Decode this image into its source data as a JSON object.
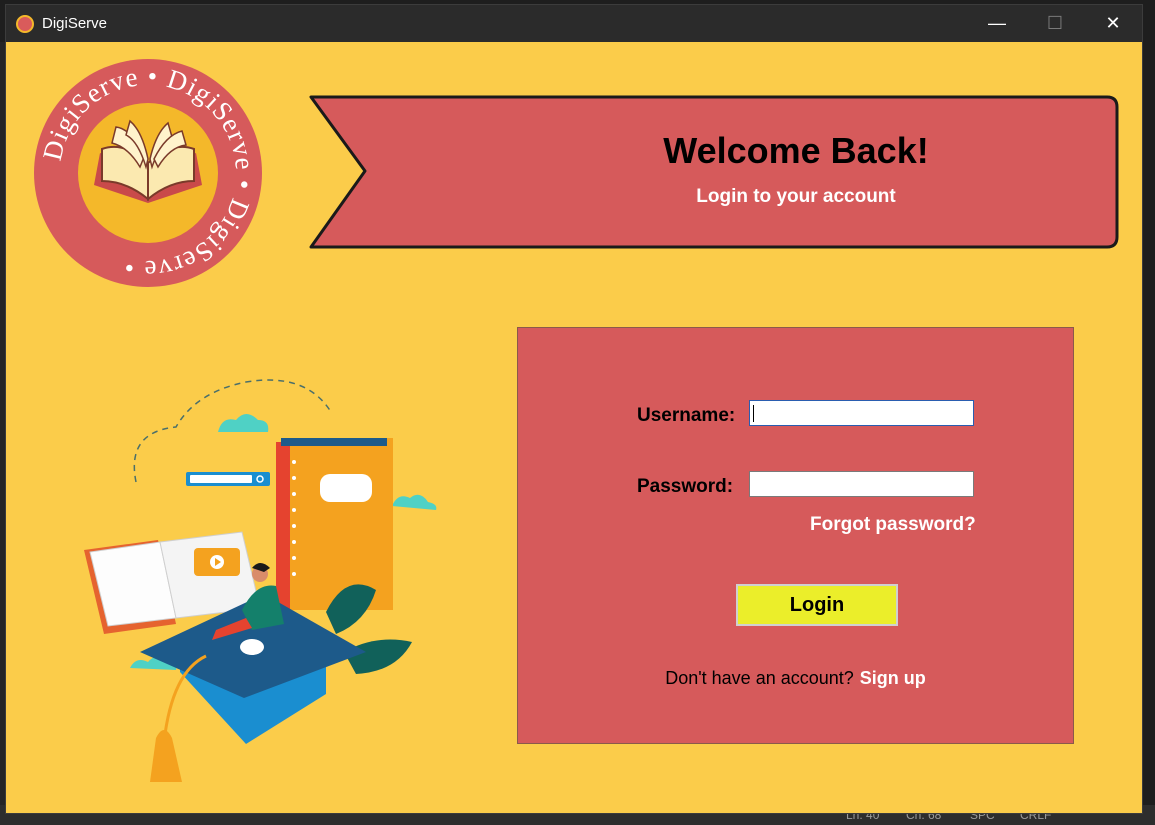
{
  "window": {
    "title": "DigiServe",
    "controls": {
      "minimize": "—",
      "maximize": "☐",
      "close": "✕"
    }
  },
  "logo": {
    "ring_text": "DigiServe • DigiServe • DigiServe •",
    "icon": "open-book-icon"
  },
  "banner": {
    "title": "Welcome Back!",
    "subtitle": "Login to your account"
  },
  "illustration": {
    "icon": "graduation-study-illustration"
  },
  "login": {
    "username_label": "Username:",
    "username_value": "",
    "password_label": "Password:",
    "password_value": "",
    "forgot_label": "Forgot password?",
    "submit_label": "Login",
    "signup_prompt": "Don't have an account?",
    "signup_link": "Sign up"
  },
  "background_status": {
    "ln": "Ln. 40",
    "col": "Cn. 68",
    "spc": "SPC",
    "eol": "CRLF"
  },
  "colors": {
    "background": "#FBCC4A",
    "panel": "#D65A5B",
    "banner": "#D65A5B",
    "button": "#EBEE2A",
    "logo_center": "#F4B82A"
  }
}
